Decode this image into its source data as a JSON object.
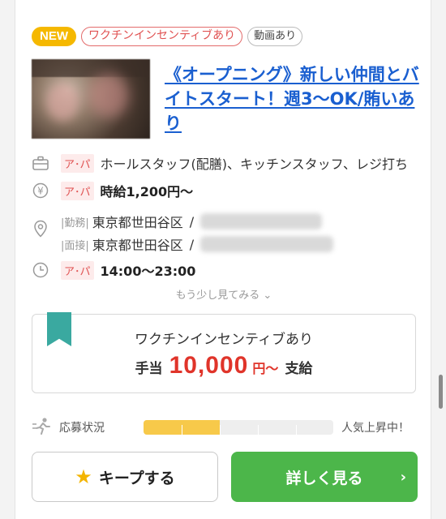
{
  "badges": {
    "new": "NEW",
    "vaccine": "ワクチンインセンティブあり",
    "video": "動画あり"
  },
  "job": {
    "title": "《オープニング》新しい仲間とバイトスタート！週3〜OK/賄いあり"
  },
  "rows": {
    "type_tag": "ア･パ",
    "occupation": "ホールスタッフ(配膳)、キッチンスタッフ、レジ打ち",
    "wage_tag": "ア･パ",
    "wage": "時給1,200円〜",
    "work_label": "|勤務|",
    "work_location": "東京都世田谷区",
    "interview_label": "|面接|",
    "interview_location": "東京都世田谷区",
    "slash": "/",
    "hours_tag": "ア･パ",
    "hours": "14:00〜23:00"
  },
  "more": "もう少し見てみる",
  "incentive": {
    "title": "ワクチンインセンティブあり",
    "pre": "手当",
    "amount": "10,000",
    "unit": "円〜",
    "post": "支給"
  },
  "popularity": {
    "label": "応募状況",
    "status": "人気上昇中！",
    "level": 0.4
  },
  "buttons": {
    "keep": "キープする",
    "detail": "詳しく見る"
  },
  "colors": {
    "link": "#1a5fd0",
    "accent_red": "#e0342a",
    "green": "#4cb64a",
    "new_badge": "#f5b800",
    "ribbon": "#3aa9a0"
  }
}
